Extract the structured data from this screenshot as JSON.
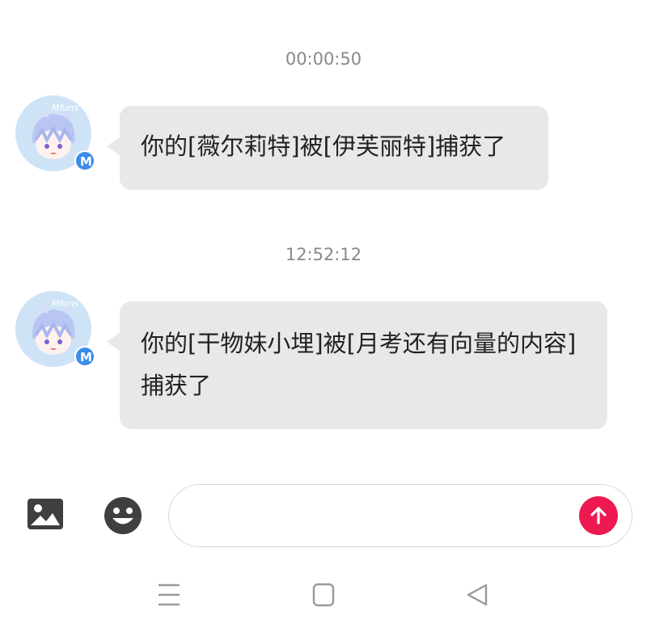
{
  "messages": [
    {
      "timestamp": "00:00:50",
      "avatar_text": "Mfuns",
      "badge": "M",
      "text": "你的[薇尔莉特]被[伊芙丽特]捕获了"
    },
    {
      "timestamp": "12:52:12",
      "avatar_text": "Mfuns",
      "badge": "M",
      "text": "你的[干物妹小埋]被[月考还有向量的内容]捕获了"
    }
  ],
  "input": {
    "value": "",
    "placeholder": "",
    "image_icon": "image-icon",
    "emoji_icon": "emoji-icon",
    "send_icon": "arrow-up-icon"
  },
  "navigation": {
    "menu_icon": "menu-icon",
    "home_icon": "square-home-icon",
    "back_icon": "triangle-back-icon"
  },
  "colors": {
    "bubble": "#e8e8e8",
    "send": "#ee1950",
    "badge": "#3b8de8",
    "avatar_bg": "#cfe3f7"
  }
}
